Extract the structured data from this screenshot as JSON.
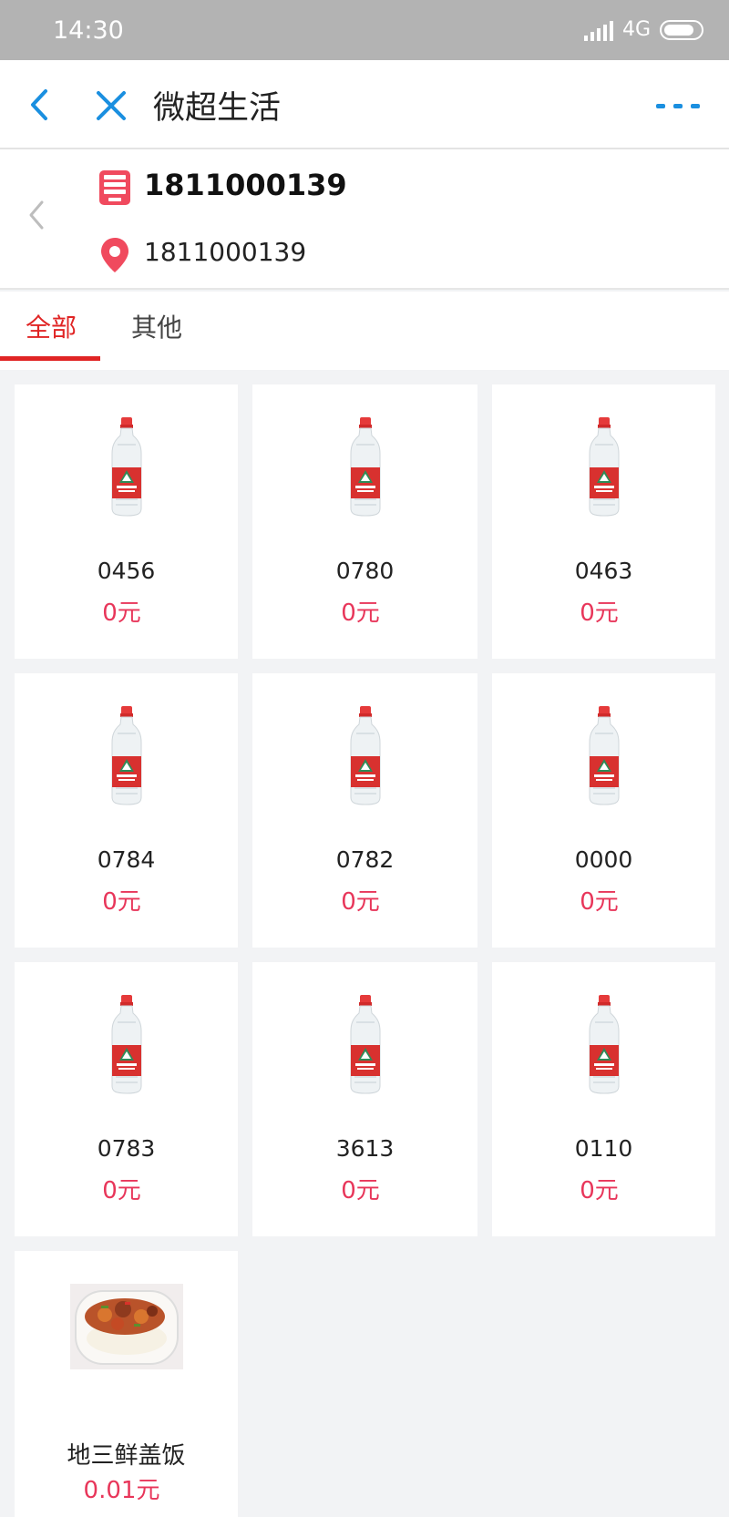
{
  "status_bar": {
    "time": "14:30",
    "network": "4G"
  },
  "nav": {
    "title": "微超生活"
  },
  "machine": {
    "name": "1811000139",
    "location": "1811000139"
  },
  "tabs": [
    {
      "label": "全部",
      "active": true
    },
    {
      "label": "其他",
      "active": false
    }
  ],
  "colors": {
    "accent_red": "#e02424",
    "price_pink": "#e8365a",
    "nav_blue": "#1a8fe0"
  },
  "products": [
    {
      "code": "0456",
      "price": "0元",
      "image": "water-bottle"
    },
    {
      "code": "0780",
      "price": "0元",
      "image": "water-bottle"
    },
    {
      "code": "0463",
      "price": "0元",
      "image": "water-bottle"
    },
    {
      "code": "0784",
      "price": "0元",
      "image": "water-bottle"
    },
    {
      "code": "0782",
      "price": "0元",
      "image": "water-bottle"
    },
    {
      "code": "0000",
      "price": "0元",
      "image": "water-bottle"
    },
    {
      "code": "0783",
      "price": "0元",
      "image": "water-bottle"
    },
    {
      "code": "3613",
      "price": "0元",
      "image": "water-bottle"
    },
    {
      "code": "0110",
      "price": "0元",
      "image": "water-bottle"
    },
    {
      "code": "地三鲜盖饭",
      "price": "0.01元",
      "image": "rice-bowl"
    }
  ]
}
